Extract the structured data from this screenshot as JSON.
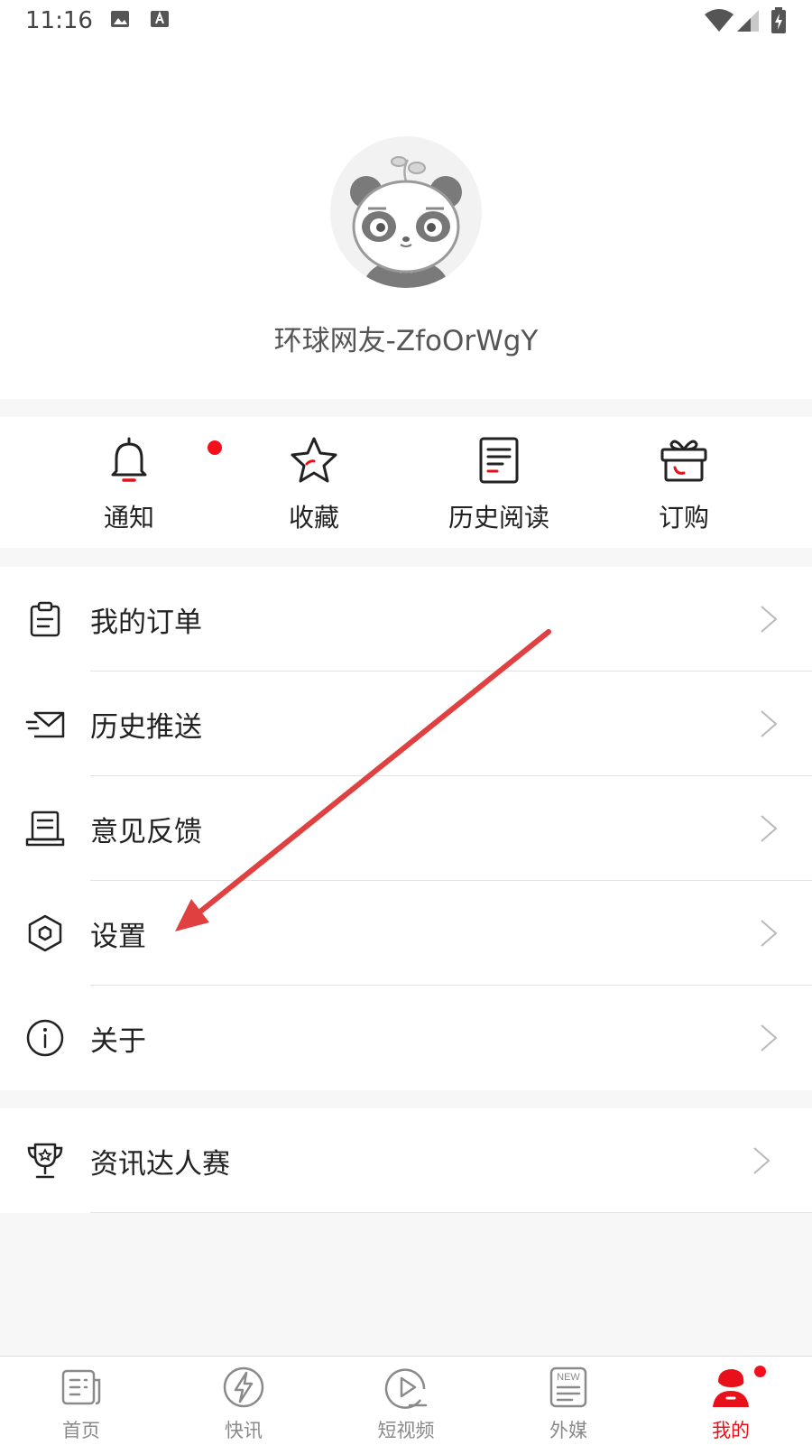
{
  "status_bar": {
    "time": "11:16"
  },
  "profile": {
    "username": "环球网友-ZfoOrWgY"
  },
  "quick_actions": [
    {
      "label": "通知",
      "icon": "bell-icon",
      "badge": true
    },
    {
      "label": "收藏",
      "icon": "star-icon"
    },
    {
      "label": "历史阅读",
      "icon": "document-icon"
    },
    {
      "label": "订购",
      "icon": "gift-box-icon"
    }
  ],
  "menu": [
    {
      "label": "我的订单",
      "icon": "clipboard-icon"
    },
    {
      "label": "历史推送",
      "icon": "envelope-icon"
    },
    {
      "label": "意见反馈",
      "icon": "feedback-icon"
    },
    {
      "label": "设置",
      "icon": "hexagon-settings-icon"
    },
    {
      "label": "关于",
      "icon": "info-icon"
    }
  ],
  "menu2": [
    {
      "label": "资讯达人赛",
      "icon": "trophy-icon"
    }
  ],
  "bottom_nav": [
    {
      "label": "首页",
      "icon": "news-icon"
    },
    {
      "label": "快讯",
      "icon": "lightning-icon"
    },
    {
      "label": "短视频",
      "icon": "play-icon"
    },
    {
      "label": "外媒",
      "icon": "new-document-icon",
      "icon_text": "NEW"
    },
    {
      "label": "我的",
      "icon": "profile-icon",
      "active": true
    }
  ],
  "colors": {
    "accent": "#e8101a",
    "badge": "#f30f1b",
    "annotation_arrow": "#e04040"
  }
}
